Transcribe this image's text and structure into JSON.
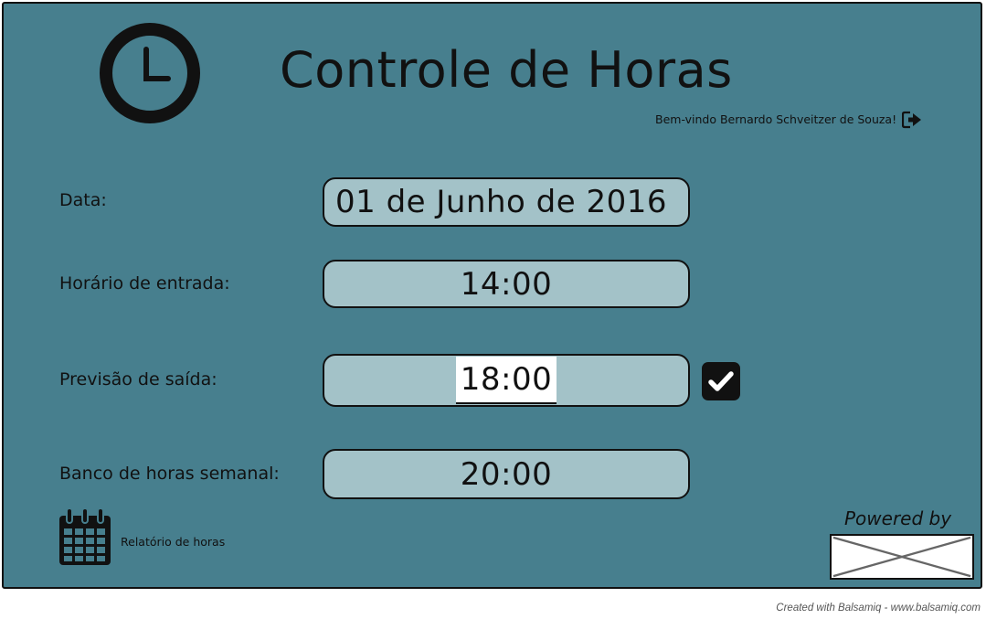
{
  "header": {
    "title": "Controle de Horas",
    "welcome_text": "Bem-vindo Bernardo Schveitzer de Souza!",
    "icon": "clock-icon",
    "logout_icon": "logout-icon"
  },
  "form": {
    "date_label": "Data:",
    "date_value": "01 de Junho de 2016",
    "entry_label": "Horário de entrada:",
    "entry_value": "14:00",
    "exit_label": "Previsão de saída:",
    "exit_value": "18:00",
    "exit_checked": true,
    "bank_label": "Banco de horas semanal:",
    "bank_value": "20:00"
  },
  "footer": {
    "report_label": "Relatório de horas",
    "report_icon": "calendar-icon",
    "powered_by": "Powered by",
    "credit": "Created with Balsamiq - www.balsamiq.com"
  },
  "colors": {
    "background": "#477f8e",
    "field": "#a3c2c8",
    "ink": "#111111"
  }
}
